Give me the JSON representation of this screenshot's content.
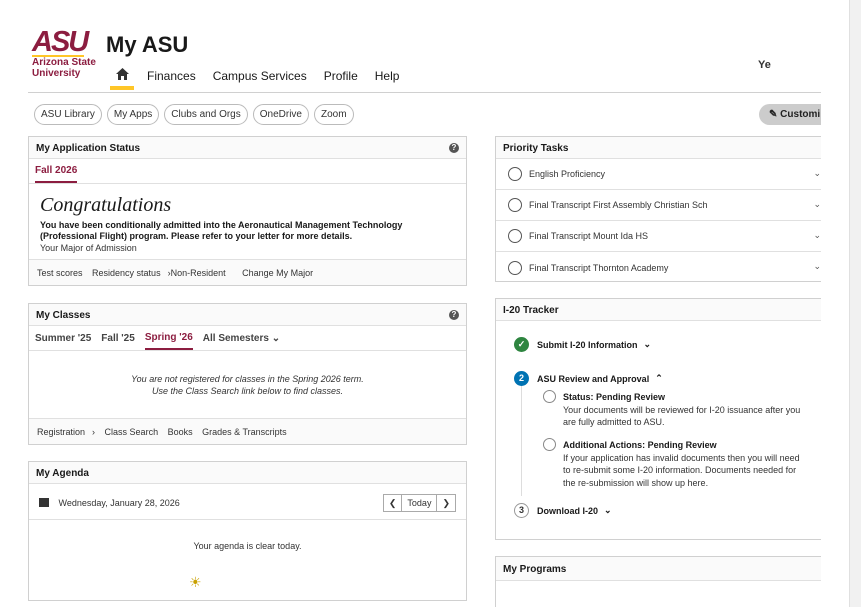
{
  "header": {
    "logo_mark": "ASU",
    "logo_sub1": "Arizona State",
    "logo_sub2": "University",
    "title": "My ASU",
    "user_name": "Ye",
    "nav": [
      "Finances",
      "Campus Services",
      "Profile",
      "Help"
    ],
    "home_icon": "home-icon"
  },
  "quicklinks": [
    "ASU Library",
    "My Apps",
    "Clubs and Orgs",
    "OneDrive",
    "Zoom"
  ],
  "customize_label": "Customi",
  "application": {
    "title": "My Application Status",
    "tab": "Fall 2026",
    "congrats": "Congratulations",
    "message": "You have been conditionally admitted into the Aeronautical Management Technology (Professional Flight) program. Please refer to your letter for more details.",
    "major": "Your Major of Admission",
    "footer": [
      "Test scores",
      "Residency status",
      "Non-Resident",
      "Change My Major"
    ]
  },
  "classes": {
    "title": "My Classes",
    "tabs": [
      "Summer '25",
      "Fall '25",
      "Spring '26",
      "All Semesters"
    ],
    "active_tab": "Spring '26",
    "message1": "You are not registered for classes in the Spring 2026 term.",
    "message2": "Use the Class Search link below to find classes.",
    "footer": [
      "Registration",
      "Class Search",
      "Books",
      "Grades & Transcripts"
    ]
  },
  "agenda": {
    "title": "My Agenda",
    "date": "Wednesday, January 28, 2026",
    "today_label": "Today",
    "clear": "Your agenda is clear today."
  },
  "priority": {
    "title": "Priority Tasks",
    "tasks": [
      "English Proficiency",
      "Final Transcript First Assembly Christian Sch",
      "Final Transcript Mount Ida HS",
      "Final Transcript Thornton Academy"
    ]
  },
  "tracker": {
    "title": "I-20 Tracker",
    "step1": "Submit I-20 Information",
    "step2_num": "2",
    "step2": "ASU Review and Approval",
    "status_title": "Status: Pending Review",
    "status_text": "Your documents will be reviewed for I-20 issuance after you are fully admitted to ASU.",
    "actions_title": "Additional Actions: Pending Review",
    "actions_text": "If your application has invalid documents then you will need to re-submit some I-20 information. Documents needed for the re-submission will show up here.",
    "step3_num": "3",
    "step3": "Download I-20"
  },
  "programs": {
    "title": "My Programs"
  },
  "colors": {
    "maroon": "#8c1d40",
    "gold": "#ffc627",
    "success": "#2e8540",
    "active": "#0073b3"
  }
}
